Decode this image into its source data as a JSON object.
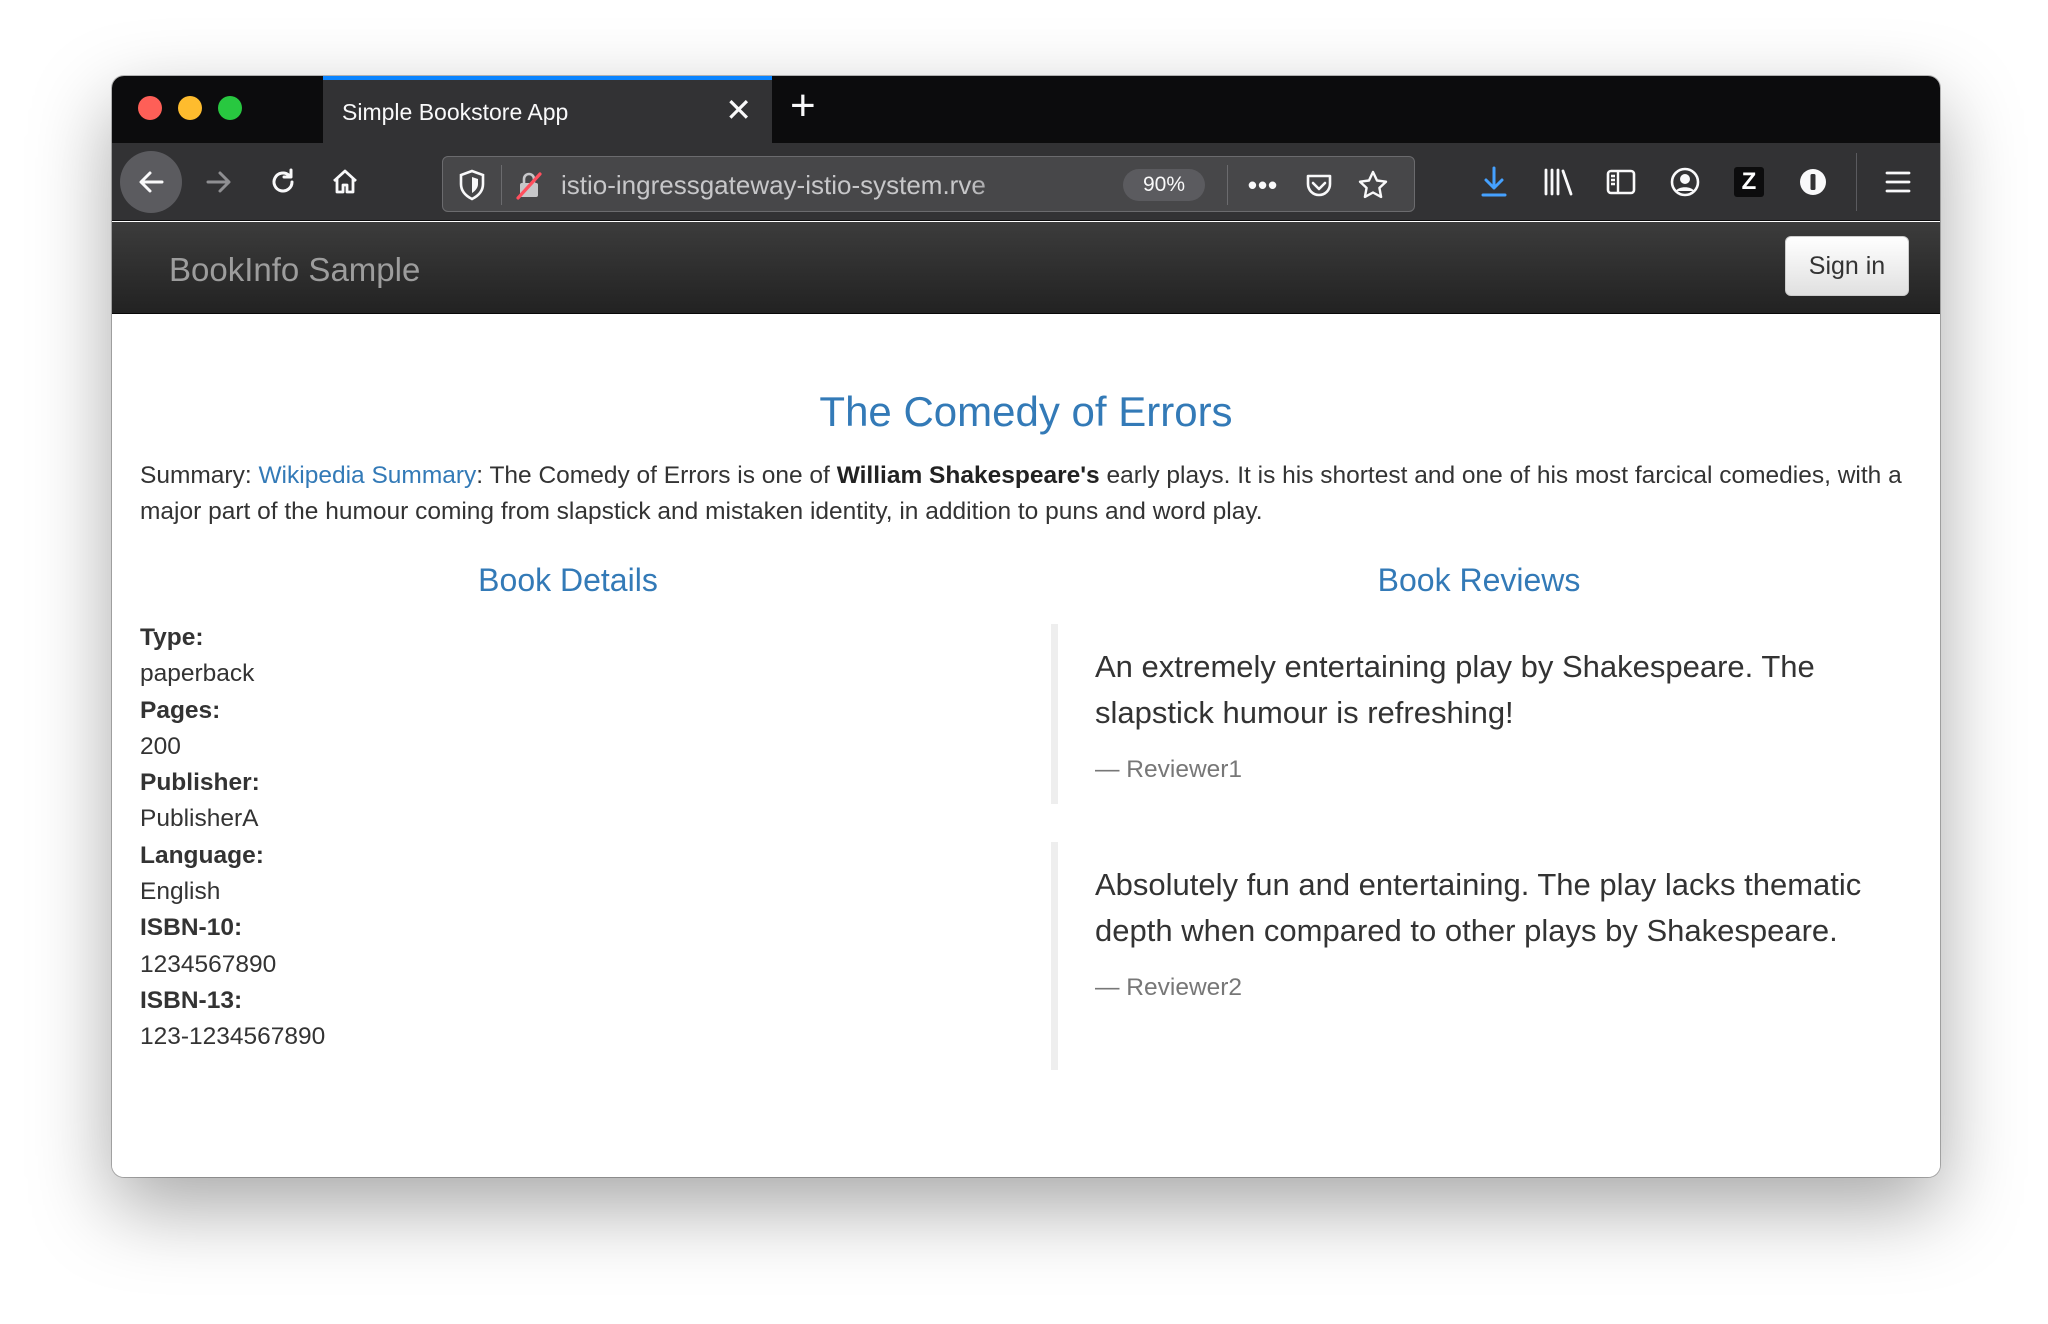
{
  "browser": {
    "tab_title": "Simple Bookstore App",
    "tab_close": "✕",
    "new_tab": "+",
    "url": "istio-ingressgateway-istio-system.rve",
    "zoom": "90%"
  },
  "site": {
    "brand": "BookInfo Sample",
    "sign_in": "Sign in"
  },
  "book": {
    "title": "The Comedy of Errors",
    "summary_label": "Summary: ",
    "summary_link": "Wikipedia Summary",
    "summary_text_1": ": The Comedy of Errors is one of ",
    "summary_bold": "William Shakespeare's",
    "summary_text_2": " early plays. It is his shortest and one of his most farcical comedies, with a major part of the humour coming from slapstick and mistaken identity, in addition to puns and word play."
  },
  "details": {
    "heading": "Book Details",
    "items": [
      {
        "label": "Type:",
        "value": "paperback"
      },
      {
        "label": "Pages:",
        "value": "200"
      },
      {
        "label": "Publisher:",
        "value": "PublisherA"
      },
      {
        "label": "Language:",
        "value": "English"
      },
      {
        "label": "ISBN-10:",
        "value": "1234567890"
      },
      {
        "label": "ISBN-13:",
        "value": "123-1234567890"
      }
    ]
  },
  "reviews": {
    "heading": "Book Reviews",
    "items": [
      {
        "text": "An extremely entertaining play by Shakespeare. The slapstick humour is refreshing!",
        "reviewer": "— Reviewer1"
      },
      {
        "text": "Absolutely fun and entertaining. The play lacks thematic depth when compared to other plays by Shakespeare.",
        "reviewer": "— Reviewer2"
      }
    ]
  },
  "icons": {
    "back": "back-arrow-icon",
    "forward": "forward-arrow-icon",
    "reload": "reload-icon",
    "home": "home-icon",
    "tracking_shield": "shield-icon",
    "insecure": "insecure-lock-icon",
    "more": "more-icon",
    "pocket": "pocket-icon",
    "bookmark": "star-icon",
    "download": "download-icon",
    "library": "library-icon",
    "sidebar": "sidebar-icon",
    "account": "account-icon",
    "extension_z": "z-extension-icon",
    "extension_1password": "onepassword-icon",
    "menu": "hamburger-menu-icon"
  },
  "colors": {
    "link": "#337ab7",
    "tab_accent": "#0a84ff",
    "download_blue": "#45a1ff",
    "insecure_red": "#ff4f5e"
  }
}
